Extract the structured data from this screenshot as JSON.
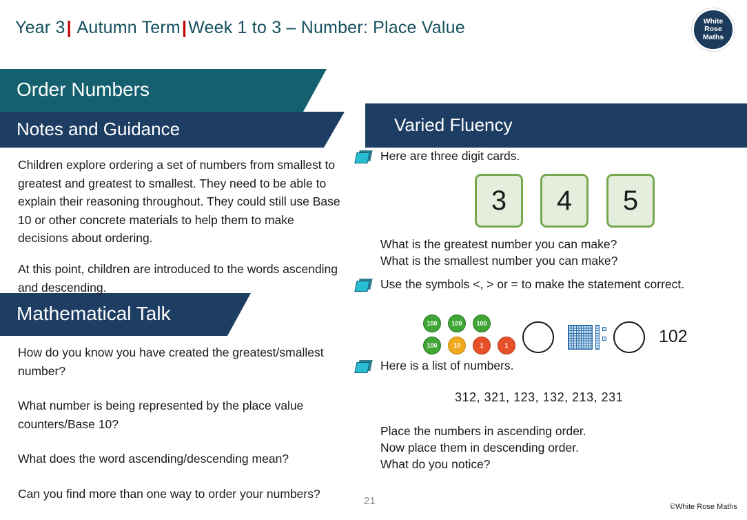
{
  "header": {
    "year": "Year 3",
    "term": "Autumn Term",
    "weeks": "Week 1 to 3 – Number: Place Value",
    "separator": "|",
    "logo": {
      "line1": "White",
      "line2": "Rose",
      "line3": "Maths"
    }
  },
  "banners": {
    "order_numbers": "Order Numbers",
    "notes_and_guidance": "Notes and Guidance",
    "mathematical_talk": "Mathematical Talk",
    "varied_fluency": "Varied Fluency"
  },
  "notes": {
    "paragraph1": "Children explore ordering a set of numbers from smallest to greatest and greatest to smallest. They need to be able to explain their reasoning throughout. They could still use Base 10 or other concrete materials to help them to make decisions about ordering.",
    "paragraph2": "At this point, children are introduced to the words ascending and descending."
  },
  "talk": {
    "q1": "How do you know you have created the greatest/smallest number?",
    "q2": "What number is being represented by the place value counters/Base 10?",
    "q3": "What does the word ascending/descending mean?",
    "q4": "Can you find more than one way to order your numbers?"
  },
  "fluency": {
    "q1_prompt": "Here are three digit cards.",
    "cards": [
      "3",
      "4",
      "5"
    ],
    "q1_sub1": "What is the greatest number you can make?",
    "q1_sub2": "What is the smallest number you can make?",
    "q2_prompt": "Use the symbols <, > or = to make the statement correct.",
    "counters_top": [
      "100",
      "100",
      "100"
    ],
    "counters_bottom": [
      "100",
      "10",
      "1",
      "1"
    ],
    "comparison_value": "102",
    "q3_prompt": "Here is a list of numbers.",
    "number_list": "312,   321,   123,   132,   213,   231",
    "q3_sub1": "Place the numbers in ascending order.",
    "q3_sub2": "Now place them in descending order.",
    "q3_sub3": "What do you notice?"
  },
  "footer": {
    "page_number": "21",
    "copyright": "©White Rose Maths"
  },
  "colors": {
    "teal": "#15606e",
    "navy": "#1d3d63",
    "header_text": "#134f5c",
    "accent_red": "#c00000",
    "card_green": "#76a84f"
  }
}
